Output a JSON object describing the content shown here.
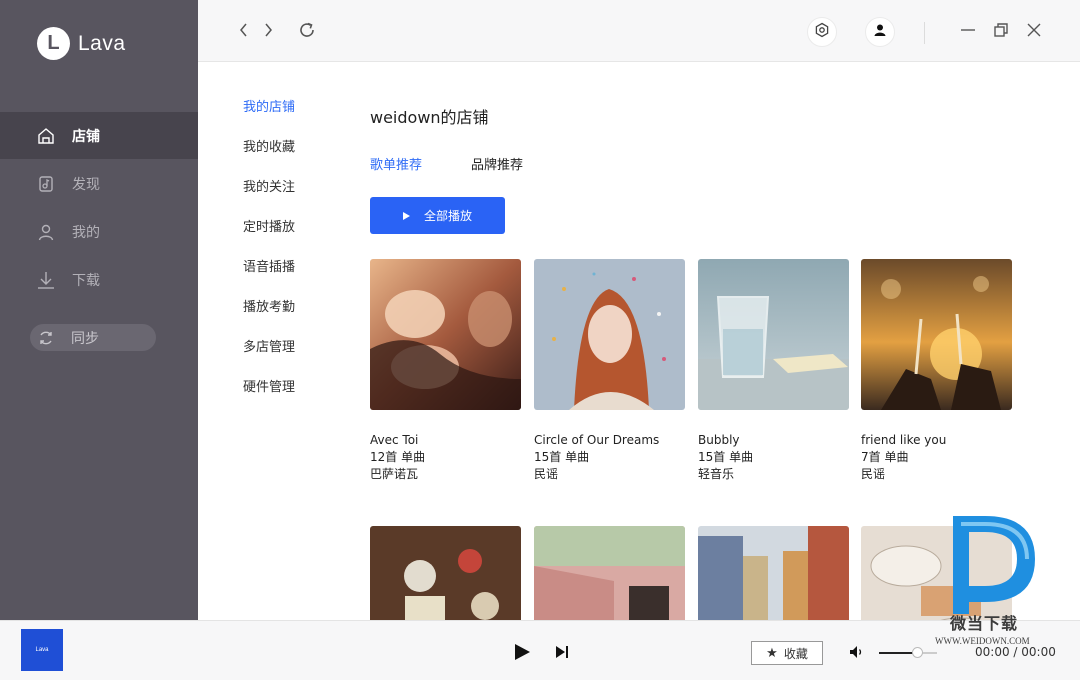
{
  "app": {
    "logo_letter": "L",
    "name": "Lava"
  },
  "sidebar": {
    "items": [
      {
        "label": "店铺",
        "icon": "store-icon",
        "active": true
      },
      {
        "label": "发现",
        "icon": "discover-icon",
        "active": false
      },
      {
        "label": "我的",
        "icon": "user-icon",
        "active": false
      },
      {
        "label": "下载",
        "icon": "download-icon",
        "active": false
      }
    ],
    "sync_label": "同步"
  },
  "topbar": {
    "icons": [
      "back-icon",
      "forward-icon",
      "refresh-icon",
      "settings-icon",
      "account-icon",
      "minimize-icon",
      "restore-icon",
      "close-icon"
    ]
  },
  "submenu": {
    "items": [
      "我的店铺",
      "我的收藏",
      "我的关注",
      "定时播放",
      "语音插播",
      "播放考勤",
      "多店管理",
      "硬件管理"
    ],
    "active_index": 0
  },
  "content": {
    "title": "weidown的店铺",
    "tabs": [
      "歌单推荐",
      "品牌推荐"
    ],
    "active_tab": 0,
    "play_all_label": "全部播放",
    "playlists": [
      {
        "title": "Avec Toi",
        "count": "12首 单曲",
        "genre": "巴萨诺瓦"
      },
      {
        "title": "Circle of Our Dreams",
        "count": "15首 单曲",
        "genre": "民谣"
      },
      {
        "title": "Bubbly",
        "count": "15首 单曲",
        "genre": "轻音乐"
      },
      {
        "title": "friend like you",
        "count": "7首 单曲",
        "genre": "民谣"
      }
    ]
  },
  "player": {
    "mini_cover_label": "Lava",
    "favorite_label": "收藏",
    "time": "00:00 / 00:00",
    "volume": 0.65
  },
  "watermark": {
    "text": "微当下载",
    "url": "WWW.WEIDOWN.COM"
  },
  "colors": {
    "sidebar": "#58555f",
    "accent": "#2a63f5"
  }
}
